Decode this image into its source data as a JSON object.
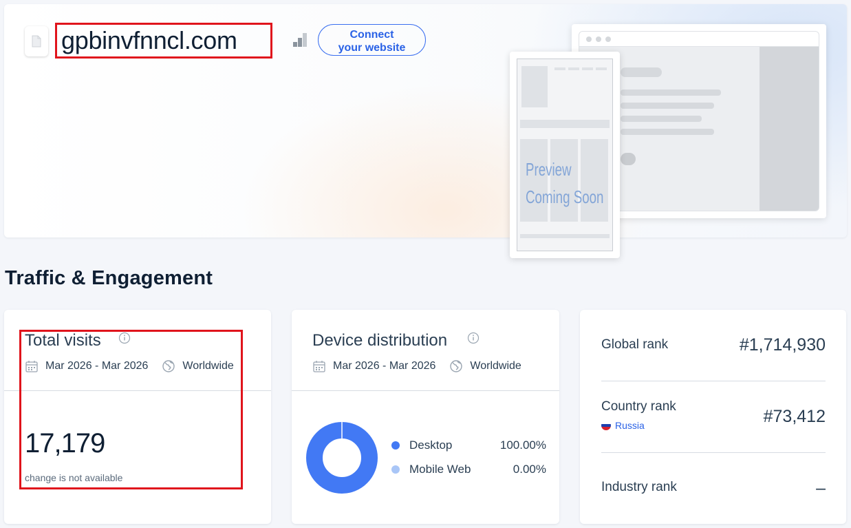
{
  "site": {
    "domain": "gpbinvfnncl.com",
    "connect_label_line1": "Connect",
    "connect_label_line2": "your website",
    "preview_line1": "Preview",
    "preview_line2": "Coming Soon"
  },
  "section": {
    "title": "Traffic & Engagement"
  },
  "total_visits": {
    "title": "Total visits",
    "date_range": "Mar 2026 - Mar 2026",
    "region": "Worldwide",
    "value": "17,179",
    "change_note": "change is not available"
  },
  "device_distribution": {
    "title": "Device distribution",
    "date_range": "Mar 2026 - Mar 2026",
    "region": "Worldwide",
    "items": [
      {
        "label": "Desktop",
        "value": "100.00%",
        "share": 100,
        "color": "#4279f4"
      },
      {
        "label": "Mobile Web",
        "value": "0.00%",
        "share": 0,
        "color": "#a9c6f7"
      }
    ]
  },
  "ranks": {
    "global_label": "Global rank",
    "global_value": "#1,714,930",
    "country_label": "Country rank",
    "country_name": "Russia",
    "country_value": "#73,412",
    "industry_label": "Industry rank",
    "industry_value": "–"
  },
  "colors": {
    "accent": "#2a62e6",
    "highlight": "#e0141c",
    "desktop": "#4279f4",
    "mobile": "#a9c6f7"
  }
}
